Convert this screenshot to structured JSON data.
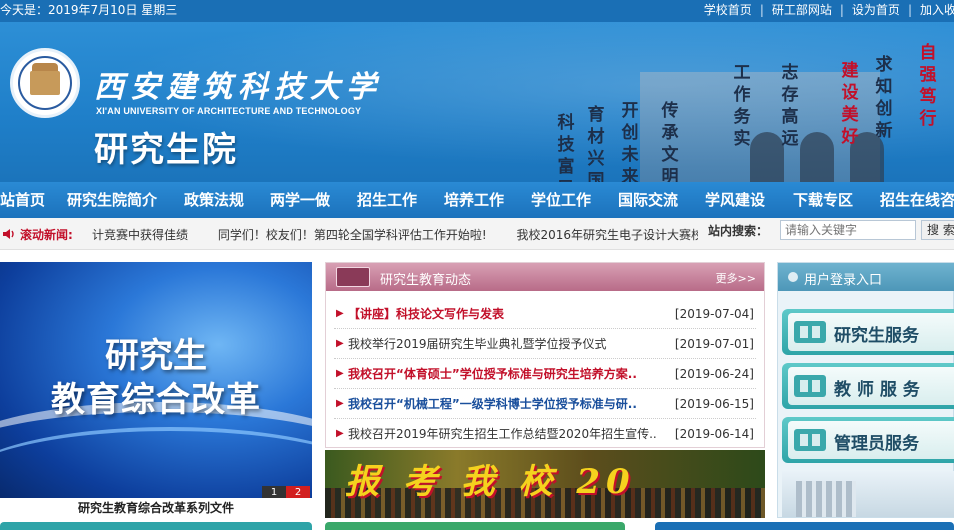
{
  "topbar": {
    "date": "今天是：2019年7月10日 星期三",
    "links": [
      "学校首页",
      "研工部网站",
      "设为首页",
      "加入收"
    ]
  },
  "banner": {
    "university_cn": "西安建筑科技大学",
    "university_en": "XI'AN UNIVERSITY OF ARCHITECTURE AND TECHNOLOGY",
    "school_title": "研究生院",
    "calligraphy_columns": [
      "科技富民",
      "育材兴国",
      "开创未来",
      "传承文明",
      "工作务实",
      "志存高远",
      "建设美好",
      "求知创新",
      "自强笃行"
    ]
  },
  "nav": {
    "items": [
      "站首页",
      "研究生院简介",
      "政策法规",
      "两学一做",
      "招生工作",
      "培养工作",
      "学位工作",
      "国际交流",
      "学风建设",
      "下载专区",
      "招生在线咨"
    ]
  },
  "ticker": {
    "label": "滚动新闻:",
    "items": [
      "计竞赛中获得佳绩",
      "同学们！校友们！第四轮全国学科评估工作开始啦!",
      "我校2016年研究生电子设计大赛校"
    ],
    "search_label": "站内搜索：",
    "search_placeholder": "请输入关键字",
    "search_button": "搜 索"
  },
  "slide": {
    "line1": "研究生",
    "line2": "教育综合改革",
    "pages": [
      "1",
      "2"
    ],
    "active_page": "2",
    "caption": "研究生教育综合改革系列文件"
  },
  "news": {
    "title": "研究生教育动态",
    "more": "更多>>",
    "items": [
      {
        "text": "【讲座】科技论文写作与发表",
        "date": "[2019-07-04]",
        "style": "hot"
      },
      {
        "text": "我校举行2019届研究生毕业典礼暨学位授予仪式",
        "date": "[2019-07-01]",
        "style": "normal"
      },
      {
        "text": "我校召开“体育硕士”学位授予标准与研究生培养方案..",
        "date": "[2019-06-24]",
        "style": "hot"
      },
      {
        "text": "我校召开“机械工程”一级学科博士学位授予标准与研..",
        "date": "[2019-06-15]",
        "style": "blue"
      },
      {
        "text": "我校召开2019年研究生招生工作总结暨2020年招生宣传..",
        "date": "[2019-06-14]",
        "style": "normal"
      }
    ],
    "banner_text": "报 考 我 校 20"
  },
  "login": {
    "title": "用户登录入口",
    "buttons": [
      "研究生服务",
      "教 师 服 务",
      "管理员服务"
    ]
  },
  "colors": {
    "primary_blue": "#1a6fb5",
    "accent_red": "#c2102a",
    "news_header": "#b86b88",
    "login_header": "#4d97b8",
    "login_button": "#2ea4a8"
  }
}
